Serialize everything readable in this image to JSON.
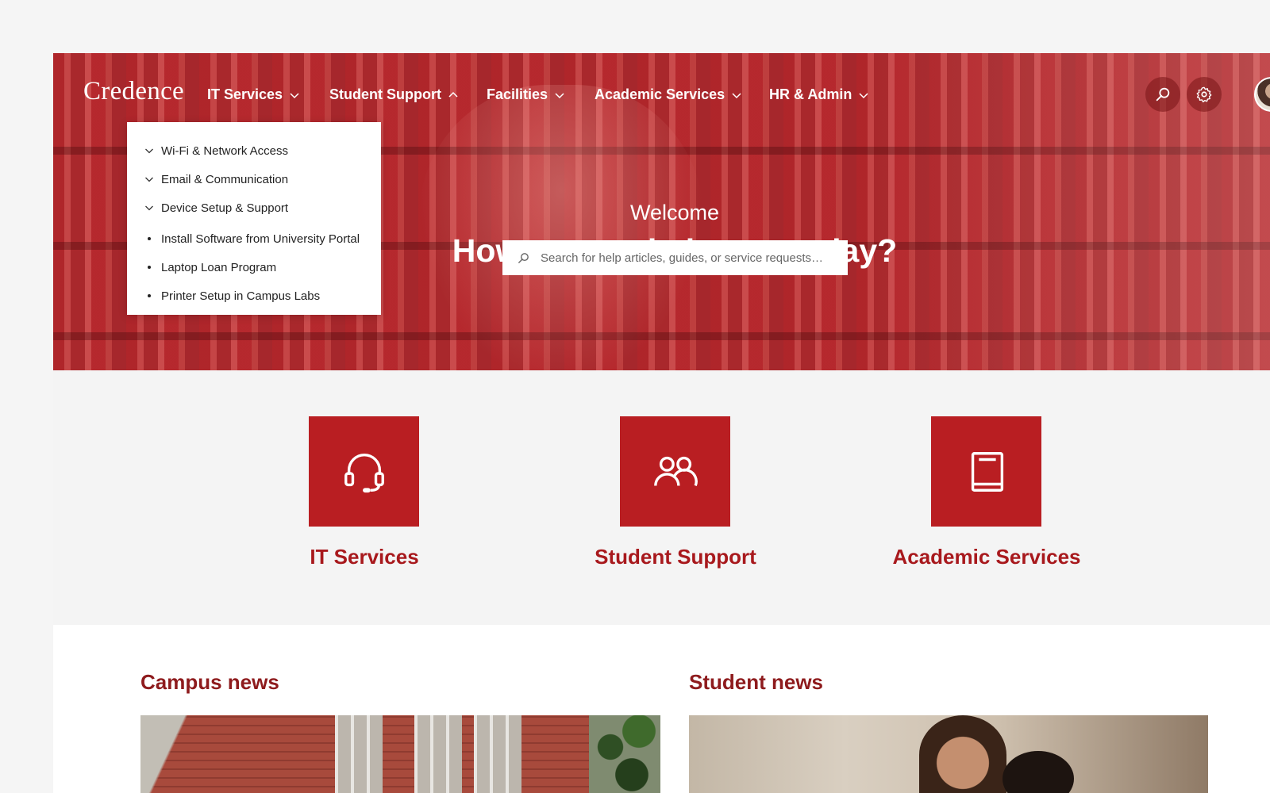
{
  "brand": {
    "logo_text": "Credence",
    "accent_color": "#b91e22",
    "heading_color": "#8e1b1d"
  },
  "nav": {
    "items": [
      {
        "label": "IT Services",
        "chevron": "chevron-down-icon"
      },
      {
        "label": "Student Support",
        "chevron": "chevron-up-icon"
      },
      {
        "label": "Facilities",
        "chevron": "chevron-down-icon"
      },
      {
        "label": "Academic Services",
        "chevron": "chevron-down-icon"
      },
      {
        "label": "HR & Admin",
        "chevron": "chevron-down-icon"
      }
    ],
    "actions": [
      "search-icon",
      "gear-icon",
      "avatar"
    ]
  },
  "dropdown": {
    "items": [
      {
        "label": "Wi-Fi & Network Access",
        "marker": "chevron-down-icon"
      },
      {
        "label": "Email & Communication",
        "marker": "chevron-down-icon"
      },
      {
        "label": "Device Setup & Support",
        "marker": "chevron-down-icon"
      },
      {
        "label": "Install Software from University Portal",
        "marker": "bullet"
      },
      {
        "label": "Laptop Loan Program",
        "marker": "bullet"
      },
      {
        "label": "Printer Setup in Campus Labs",
        "marker": "bullet"
      }
    ]
  },
  "hero": {
    "welcome": "Welcome",
    "headline": "How can we help you today?",
    "search_placeholder": "Search for help articles, guides, or service requests…"
  },
  "categories": [
    {
      "label": "IT Services",
      "icon": "headset-icon"
    },
    {
      "label": "Student Support",
      "icon": "people-icon"
    },
    {
      "label": "Academic Services",
      "icon": "book-icon"
    }
  ],
  "news": {
    "campus_title": "Campus news",
    "student_title": "Student news"
  }
}
